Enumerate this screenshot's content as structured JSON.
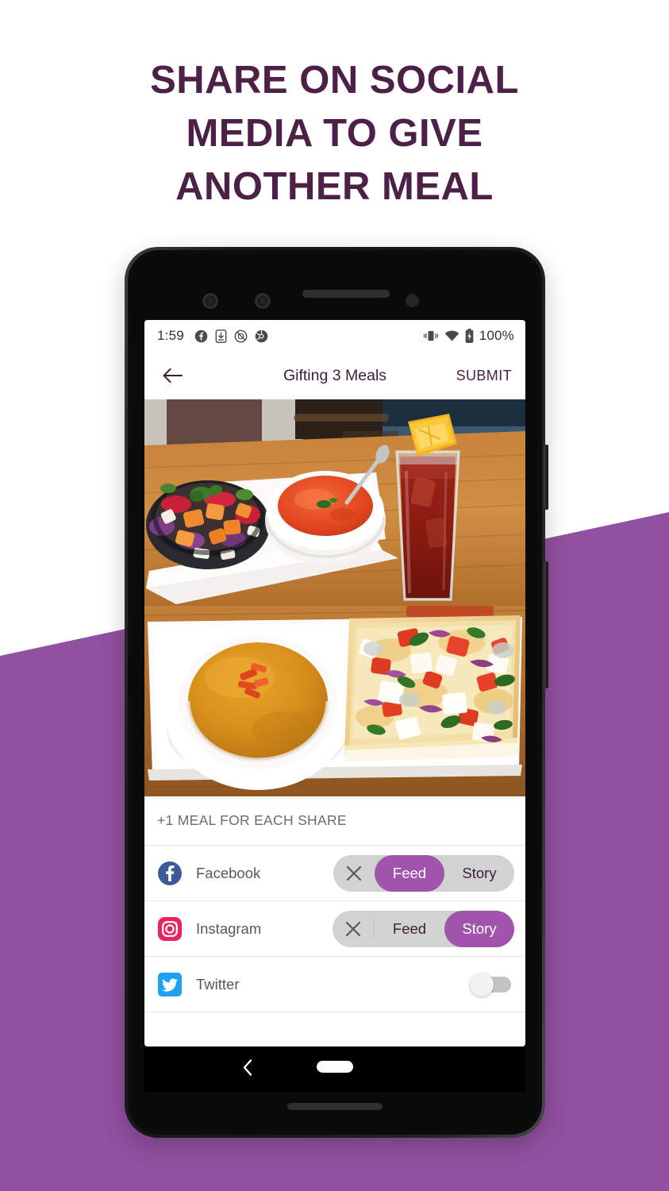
{
  "headline": {
    "lines": [
      "SHARE ON SOCIAL",
      "MEDIA TO GIVE",
      "ANOTHER MEAL"
    ],
    "color": "#4d2147"
  },
  "background": {
    "page_color": "#ffffff",
    "accent_shape_color": "#9250a0"
  },
  "phone": {
    "frame_color": "#161617",
    "hardware": {
      "camera_1": "camera-lens",
      "camera_2": "camera-lens",
      "earpiece": "earpiece-speaker",
      "sensor": "proximity-sensor",
      "power_button": "power-button",
      "volume_button": "volume-rocker",
      "bottom_speaker": "bottom-speaker-grille"
    }
  },
  "status_bar": {
    "time": "1:59",
    "left_icons": [
      "facebook-icon",
      "download-icon",
      "do-not-disturb-icon",
      "chrome-icon"
    ],
    "right_icons": [
      "vibrate-icon",
      "wifi-icon",
      "battery-icon"
    ],
    "battery_percent": "100%"
  },
  "app_bar": {
    "back_icon": "back-arrow-icon",
    "title": "Gifting 3 Meals",
    "submit_label": "SUBMIT",
    "title_color": "#3a1f38",
    "submit_color": "#4d2147"
  },
  "photos": [
    {
      "name": "meal-photo-top",
      "description": "Salad bowl, tomato soup and iced tea with lemon on a wooden table"
    },
    {
      "name": "meal-photo-bottom",
      "description": "Butternut squash soup and flatbread pizza on a white plate"
    }
  ],
  "share_section": {
    "caption": "+1 MEAL FOR EACH SHARE",
    "accent_color": "#a054ab",
    "rows": [
      {
        "id": "facebook",
        "label": "Facebook",
        "icon": "facebook-icon",
        "icon_color": "#3d5a98",
        "control": "segmented",
        "close_label": "✕",
        "options": [
          "Feed",
          "Story"
        ],
        "selected": "Feed"
      },
      {
        "id": "instagram",
        "label": "Instagram",
        "icon": "instagram-icon",
        "icon_color": "#e8245f",
        "control": "segmented",
        "close_label": "✕",
        "options": [
          "Feed",
          "Story"
        ],
        "selected": "Story"
      },
      {
        "id": "twitter",
        "label": "Twitter",
        "icon": "twitter-icon",
        "icon_color": "#1da1f2",
        "control": "toggle",
        "enabled": false
      }
    ]
  },
  "nav_bar": {
    "back_icon": "nav-back-chevron-icon",
    "home_indicator": "home-pill-indicator"
  }
}
